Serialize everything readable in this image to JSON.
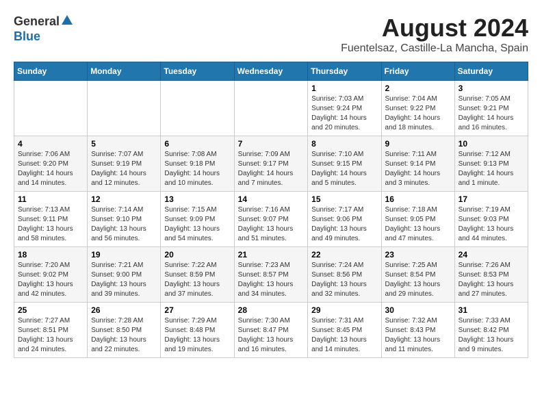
{
  "logo": {
    "general": "General",
    "blue": "Blue"
  },
  "title": {
    "month_year": "August 2024",
    "location": "Fuentelsaz, Castille-La Mancha, Spain"
  },
  "headers": [
    "Sunday",
    "Monday",
    "Tuesday",
    "Wednesday",
    "Thursday",
    "Friday",
    "Saturday"
  ],
  "weeks": [
    [
      {
        "day": "",
        "info": ""
      },
      {
        "day": "",
        "info": ""
      },
      {
        "day": "",
        "info": ""
      },
      {
        "day": "",
        "info": ""
      },
      {
        "day": "1",
        "info": "Sunrise: 7:03 AM\nSunset: 9:24 PM\nDaylight: 14 hours\nand 20 minutes."
      },
      {
        "day": "2",
        "info": "Sunrise: 7:04 AM\nSunset: 9:22 PM\nDaylight: 14 hours\nand 18 minutes."
      },
      {
        "day": "3",
        "info": "Sunrise: 7:05 AM\nSunset: 9:21 PM\nDaylight: 14 hours\nand 16 minutes."
      }
    ],
    [
      {
        "day": "4",
        "info": "Sunrise: 7:06 AM\nSunset: 9:20 PM\nDaylight: 14 hours\nand 14 minutes."
      },
      {
        "day": "5",
        "info": "Sunrise: 7:07 AM\nSunset: 9:19 PM\nDaylight: 14 hours\nand 12 minutes."
      },
      {
        "day": "6",
        "info": "Sunrise: 7:08 AM\nSunset: 9:18 PM\nDaylight: 14 hours\nand 10 minutes."
      },
      {
        "day": "7",
        "info": "Sunrise: 7:09 AM\nSunset: 9:17 PM\nDaylight: 14 hours\nand 7 minutes."
      },
      {
        "day": "8",
        "info": "Sunrise: 7:10 AM\nSunset: 9:15 PM\nDaylight: 14 hours\nand 5 minutes."
      },
      {
        "day": "9",
        "info": "Sunrise: 7:11 AM\nSunset: 9:14 PM\nDaylight: 14 hours\nand 3 minutes."
      },
      {
        "day": "10",
        "info": "Sunrise: 7:12 AM\nSunset: 9:13 PM\nDaylight: 14 hours\nand 1 minute."
      }
    ],
    [
      {
        "day": "11",
        "info": "Sunrise: 7:13 AM\nSunset: 9:11 PM\nDaylight: 13 hours\nand 58 minutes."
      },
      {
        "day": "12",
        "info": "Sunrise: 7:14 AM\nSunset: 9:10 PM\nDaylight: 13 hours\nand 56 minutes."
      },
      {
        "day": "13",
        "info": "Sunrise: 7:15 AM\nSunset: 9:09 PM\nDaylight: 13 hours\nand 54 minutes."
      },
      {
        "day": "14",
        "info": "Sunrise: 7:16 AM\nSunset: 9:07 PM\nDaylight: 13 hours\nand 51 minutes."
      },
      {
        "day": "15",
        "info": "Sunrise: 7:17 AM\nSunset: 9:06 PM\nDaylight: 13 hours\nand 49 minutes."
      },
      {
        "day": "16",
        "info": "Sunrise: 7:18 AM\nSunset: 9:05 PM\nDaylight: 13 hours\nand 47 minutes."
      },
      {
        "day": "17",
        "info": "Sunrise: 7:19 AM\nSunset: 9:03 PM\nDaylight: 13 hours\nand 44 minutes."
      }
    ],
    [
      {
        "day": "18",
        "info": "Sunrise: 7:20 AM\nSunset: 9:02 PM\nDaylight: 13 hours\nand 42 minutes."
      },
      {
        "day": "19",
        "info": "Sunrise: 7:21 AM\nSunset: 9:00 PM\nDaylight: 13 hours\nand 39 minutes."
      },
      {
        "day": "20",
        "info": "Sunrise: 7:22 AM\nSunset: 8:59 PM\nDaylight: 13 hours\nand 37 minutes."
      },
      {
        "day": "21",
        "info": "Sunrise: 7:23 AM\nSunset: 8:57 PM\nDaylight: 13 hours\nand 34 minutes."
      },
      {
        "day": "22",
        "info": "Sunrise: 7:24 AM\nSunset: 8:56 PM\nDaylight: 13 hours\nand 32 minutes."
      },
      {
        "day": "23",
        "info": "Sunrise: 7:25 AM\nSunset: 8:54 PM\nDaylight: 13 hours\nand 29 minutes."
      },
      {
        "day": "24",
        "info": "Sunrise: 7:26 AM\nSunset: 8:53 PM\nDaylight: 13 hours\nand 27 minutes."
      }
    ],
    [
      {
        "day": "25",
        "info": "Sunrise: 7:27 AM\nSunset: 8:51 PM\nDaylight: 13 hours\nand 24 minutes."
      },
      {
        "day": "26",
        "info": "Sunrise: 7:28 AM\nSunset: 8:50 PM\nDaylight: 13 hours\nand 22 minutes."
      },
      {
        "day": "27",
        "info": "Sunrise: 7:29 AM\nSunset: 8:48 PM\nDaylight: 13 hours\nand 19 minutes."
      },
      {
        "day": "28",
        "info": "Sunrise: 7:30 AM\nSunset: 8:47 PM\nDaylight: 13 hours\nand 16 minutes."
      },
      {
        "day": "29",
        "info": "Sunrise: 7:31 AM\nSunset: 8:45 PM\nDaylight: 13 hours\nand 14 minutes."
      },
      {
        "day": "30",
        "info": "Sunrise: 7:32 AM\nSunset: 8:43 PM\nDaylight: 13 hours\nand 11 minutes."
      },
      {
        "day": "31",
        "info": "Sunrise: 7:33 AM\nSunset: 8:42 PM\nDaylight: 13 hours\nand 9 minutes."
      }
    ]
  ]
}
